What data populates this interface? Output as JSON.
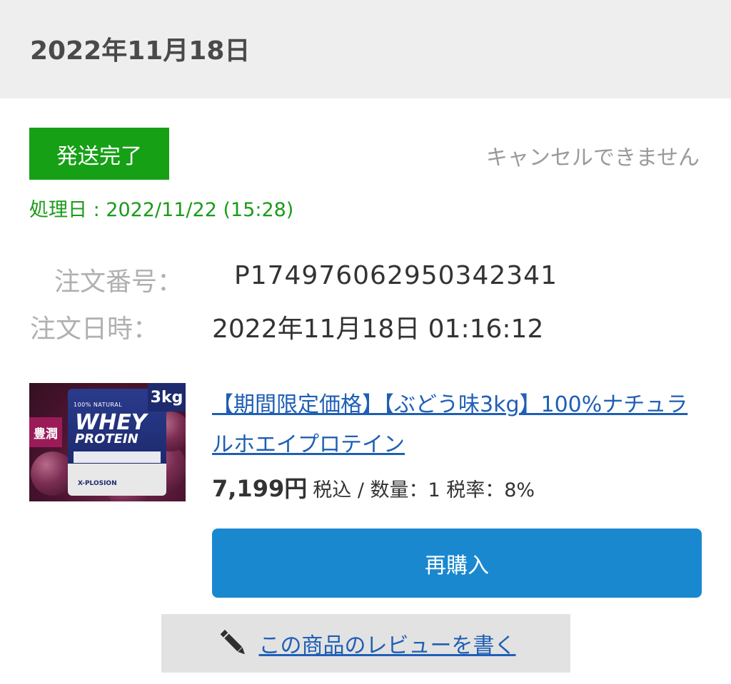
{
  "header": {
    "date": "2022年11月18日"
  },
  "order": {
    "status_badge": "発送完了",
    "cancel_note": "キャンセルできません",
    "processed": "処理日 : 2022/11/22 (15:28)",
    "number_label": "注文番号：",
    "number_value": "P174976062950342341",
    "date_label": "注文日時：",
    "date_value": "2022年11月18日 01:16:12"
  },
  "product": {
    "title": "【期間限定価格】【ぶどう味3kg】100%ナチュラルホエイプロテイン",
    "price": "7,199円",
    "price_meta": "税込 / 数量：1 税率：8%",
    "image": {
      "weight_badge": "3kg",
      "flavor_badge": "豊潤",
      "bag_top": "100% NATURAL",
      "bag_title_1": "WHEY",
      "bag_title_2": "PROTEIN",
      "bag_brand": "X-PLOSION"
    }
  },
  "actions": {
    "rebuy_label": "再購入",
    "review_label": "この商品のレビューを書く"
  },
  "colors": {
    "status_green": "#16a016",
    "processed_green": "#1a9b1a",
    "primary_blue": "#1a88cf",
    "link_blue": "#1f5fb5",
    "header_gray": "#eeeeee"
  },
  "icons": {
    "review": "pencil-icon"
  }
}
